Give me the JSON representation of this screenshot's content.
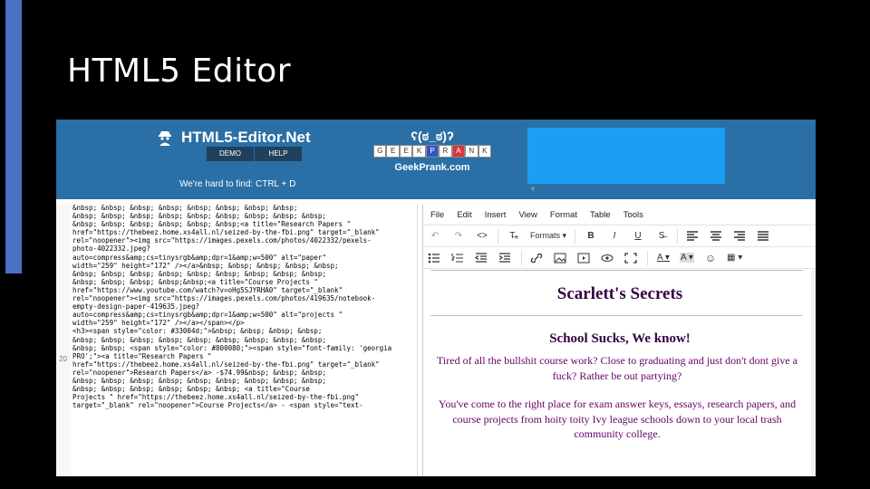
{
  "slide": {
    "title": "HTML5 Editor"
  },
  "site": {
    "brand": "HTML5-Editor.Net",
    "nav": [
      "DEMO",
      "HELP"
    ],
    "tagline": "We're hard to find: CTRL + D",
    "ad": {
      "lenny": "ʕ(ಠ_ಠ)ʔ",
      "letters": [
        "G",
        "E",
        "E",
        "K",
        "P",
        "R",
        "A",
        "N",
        "K"
      ],
      "domain": "GeekPrank.com"
    },
    "colors": {
      "header": "#2a6fa6",
      "ad_box": "#1a9ff3",
      "heading": "#330044",
      "body_text": "#660066"
    }
  },
  "code": {
    "line_number": "20",
    "text": "&nbsp; &nbsp; &nbsp; &nbsp; &nbsp; &nbsp; &nbsp; &nbsp;\n&nbsp; &nbsp; &nbsp; &nbsp; &nbsp; &nbsp; &nbsp; &nbsp; &nbsp;\n&nbsp; &nbsp; &nbsp; &nbsp; &nbsp; &nbsp;<a title=\"Research Papers \"\nhref=\"https://thebeez.home.xs4all.nl/seized-by-the-fbi.png\" target=\"_blank\"\nrel=\"noopener\"><img src=\"https://images.pexels.com/photos/4022332/pexels-\nphoto-4022332.jpeg?\nauto=compress&amp;cs=tinysrgb&amp;dpr=1&amp;w=500\" alt=\"paper\"\nwidth=\"259\" height=\"172\" /></a>&nbsp; &nbsp; &nbsp; &nbsp; &nbsp;\n&nbsp; &nbsp; &nbsp; &nbsp; &nbsp; &nbsp; &nbsp; &nbsp; &nbsp;\n&nbsp; &nbsp; &nbsp; &nbsp;&nbsp;<a title=\"Course Projects \"\nhref=\"https://www.youtube.com/watch?v=oHg5SJYRHA0\" target=\"_blank\"\nrel=\"noopener\"><img src=\"https://images.pexels.com/photos/419635/notebook-\nempty-design-paper-419635.jpeg?\nauto=compress&amp;cs=tinysrgb&amp;dpr=1&amp;w=500\" alt=\"projects \"\nwidth=\"259\" height=\"172\" /></a></span></p>\n<h3><span style=\"color: #33004d;\">&nbsp; &nbsp; &nbsp; &nbsp;\n&nbsp; &nbsp; &nbsp; &nbsp; &nbsp; &nbsp; &nbsp; &nbsp; &nbsp;\n&nbsp; &nbsp; <span style=\"color: #800080;\"><span style=\"font-family: 'georgia\nPRO';\"><a title=\"Research Papers \"\nhref=\"https://thebeez.home.xs4all.nl/seized-by-the-fbi.png\" target=\"_blank\"\nrel=\"noopener\">Research Papers</a> -$74.99&nbsp; &nbsp; &nbsp;\n&nbsp; &nbsp; &nbsp; &nbsp; &nbsp; &nbsp; &nbsp; &nbsp; &nbsp;\n&nbsp; &nbsp; &nbsp; &nbsp; &nbsp; &nbsp; <a title=\"Course\nProjects \" href=\"https://thebeez.home.xs4all.nl/seized-by-the-fbi.png\"\ntarget=\"_blank\" rel=\"noopener\">Course Projects</a> - <span style=\"text-"
  },
  "editor": {
    "menu": [
      "File",
      "Edit",
      "Insert",
      "View",
      "Format",
      "Table",
      "Tools"
    ],
    "toolbar1": {
      "undo": "↶",
      "redo": "↷",
      "source": "<>",
      "clear_format": "T̶ₓ",
      "formats": "Formats ▾",
      "bold": "B",
      "italic": "I",
      "underline": "U",
      "strike": "S̶"
    },
    "toolbar2": {
      "text_color": "A ▾",
      "bg_color": "A ▾",
      "emoji": "☺",
      "table": "▦ ▾"
    },
    "document": {
      "heading": "Scarlett's Secrets",
      "subheading": "School Sucks, We know!",
      "para1": "Tired of all the bullshit course work? Close to graduating and just don't dont give a fuck? Rather be out partying?",
      "para2": "You've come to the right place for exam answer keys, essays, research papers, and course projects from hoity toity Ivy league schools down to your local trash community college."
    }
  }
}
